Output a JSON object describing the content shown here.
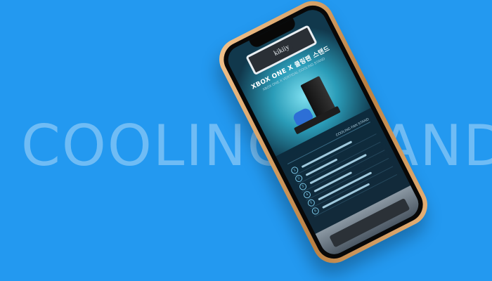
{
  "background": {
    "color": "#2399f0",
    "word": "COOLING STAND",
    "word_color": "#6fbcf5"
  },
  "phone": {
    "frame_color": "#c98f53",
    "banner": {
      "logo_text": "kikiiy",
      "title": "XBOX ONE X 쿨링팬 스탠드",
      "subtitle": "XBOX ONE X VERTICAL COOLING STAND"
    },
    "list": {
      "header": "COOLING FAN STAND",
      "items": [
        {
          "num": "1"
        },
        {
          "num": "2"
        },
        {
          "num": "3"
        },
        {
          "num": "4"
        },
        {
          "num": "5"
        },
        {
          "num": "6"
        }
      ]
    }
  }
}
